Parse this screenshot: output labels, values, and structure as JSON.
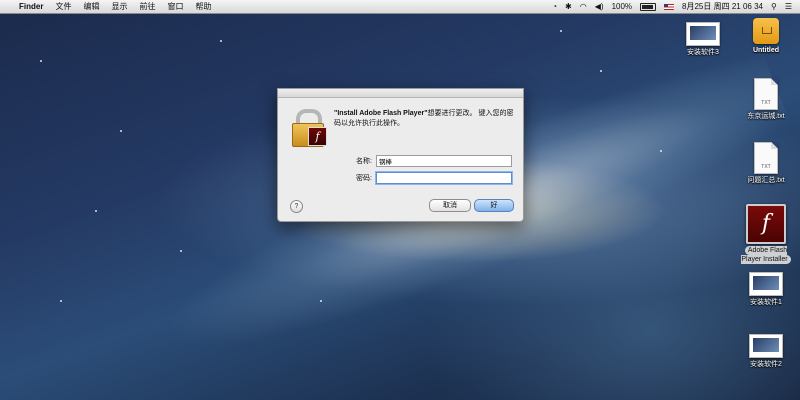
{
  "menubar": {
    "app_name": "Finder",
    "menus": [
      "文件",
      "编辑",
      "显示",
      "前往",
      "窗口",
      "帮助"
    ],
    "battery_percent": "100%",
    "datetime": "8月25日 周四  21 06 34"
  },
  "dialog": {
    "message_app": "\"Install Adobe Flash Player\"",
    "message_rest": "想要进行更改。 键入您的密码以允许执行此操作。",
    "name_label": "名称:",
    "name_value": "钢棒",
    "password_label": "密码:",
    "password_value": "",
    "help_label": "?",
    "cancel_label": "取消",
    "ok_label": "好"
  },
  "desktop_icons": {
    "icon1": {
      "label": "安装软件3",
      "type": "screenshot"
    },
    "icon2": {
      "label": "Untitled",
      "type": "drive"
    },
    "icon3": {
      "label": "东京运城.txt",
      "badge": "TXT"
    },
    "icon4": {
      "label": "问题汇总.txt",
      "badge": "TXT"
    },
    "icon5": {
      "label": "Adobe Flash Player Installer",
      "glyph": "f"
    },
    "icon6": {
      "label": "安装软件1",
      "type": "screenshot"
    },
    "icon7": {
      "label": "安装软件2",
      "type": "screenshot"
    }
  },
  "colors": {
    "default_button": "#7fb2ea",
    "flash_red": "#6b0808",
    "lock_gold": "#e0a83a"
  }
}
